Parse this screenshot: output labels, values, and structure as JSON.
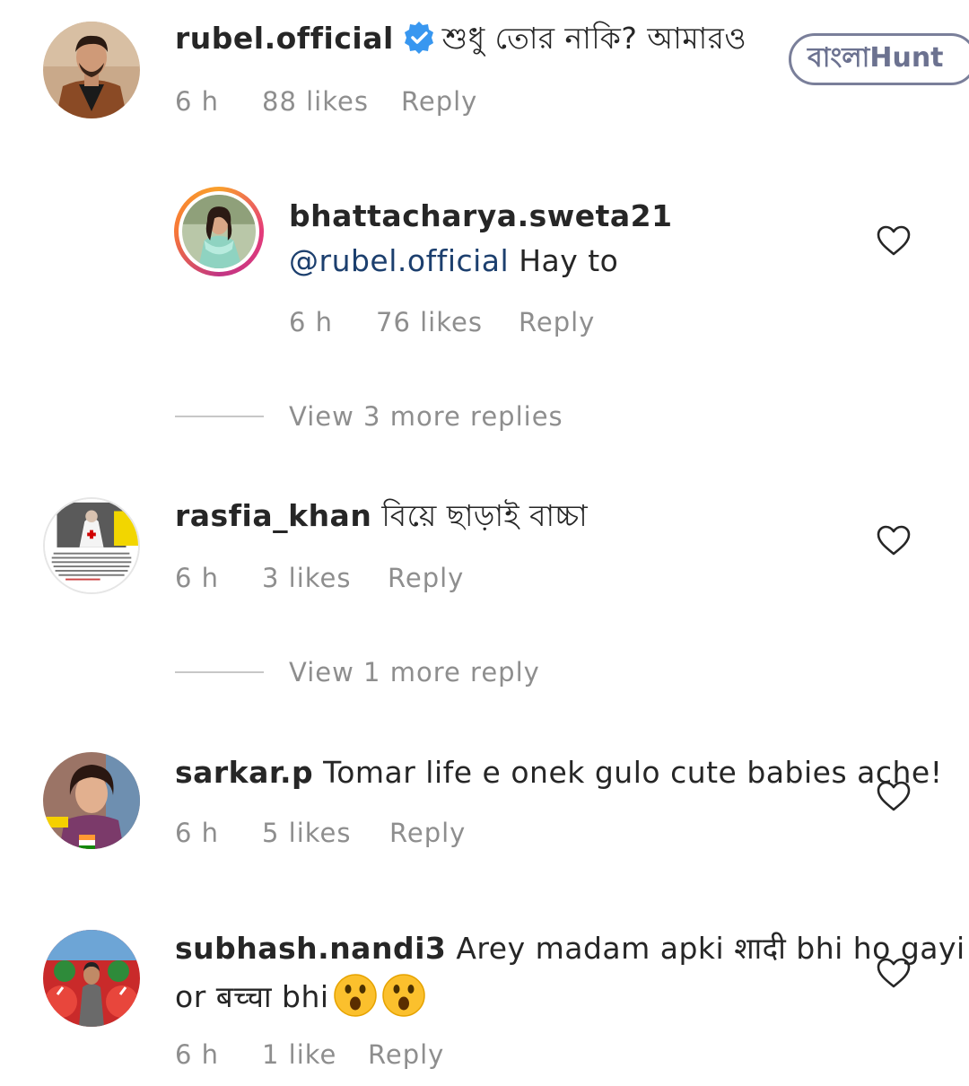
{
  "watermark": {
    "text": "বাংলাHunt"
  },
  "comments": [
    {
      "username": "rubel.official",
      "verified": true,
      "text": "শুধু তোর নাকি? আমারও",
      "time": "6 h",
      "likes": "88 likes",
      "reply": "Reply",
      "avatar": "man-in-brown-jacket-avatar"
    },
    {
      "username": "bhattacharya.sweta21",
      "mention": "@rubel.official",
      "text": "Hay to",
      "time": "6 h",
      "likes": "76 likes",
      "reply": "Reply",
      "avatar": "woman-in-green-dress-avatar",
      "has_story_ring": true,
      "is_reply": true
    },
    {
      "username": "rasfia_khan",
      "text": "বিয়ে ছাড়াই বাচ্চা",
      "time": "6 h",
      "likes": "3 likes",
      "reply": "Reply",
      "avatar": "nurse-newspaper-avatar"
    },
    {
      "username": "sarkar.p",
      "text": "Tomar life e onek gulo cute babies ache!",
      "time": "6 h",
      "likes": "5 likes",
      "reply": "Reply",
      "avatar": "woman-portrait-avatar"
    },
    {
      "username": "subhash.nandi3",
      "text_line1": "Arey madam apki शादी bhi ho gayi",
      "text_line2_prefix": "or बच्चा bhi",
      "time": "6 h",
      "likes": "1 like",
      "reply": "Reply",
      "avatar": "man-red-decor-avatar",
      "emojis": [
        "hushed-face",
        "hushed-face"
      ]
    }
  ],
  "view_more": [
    {
      "label": "View 3 more replies"
    },
    {
      "label": "View 1 more reply"
    }
  ],
  "icons": {
    "heart": "heart-outline-icon",
    "verified": "verified-badge-icon"
  },
  "colors": {
    "username": "#262626",
    "meta": "#8e8e8e",
    "mention": "#1c3f6e",
    "verified": "#3897f0",
    "watermark": "#6c7290"
  }
}
